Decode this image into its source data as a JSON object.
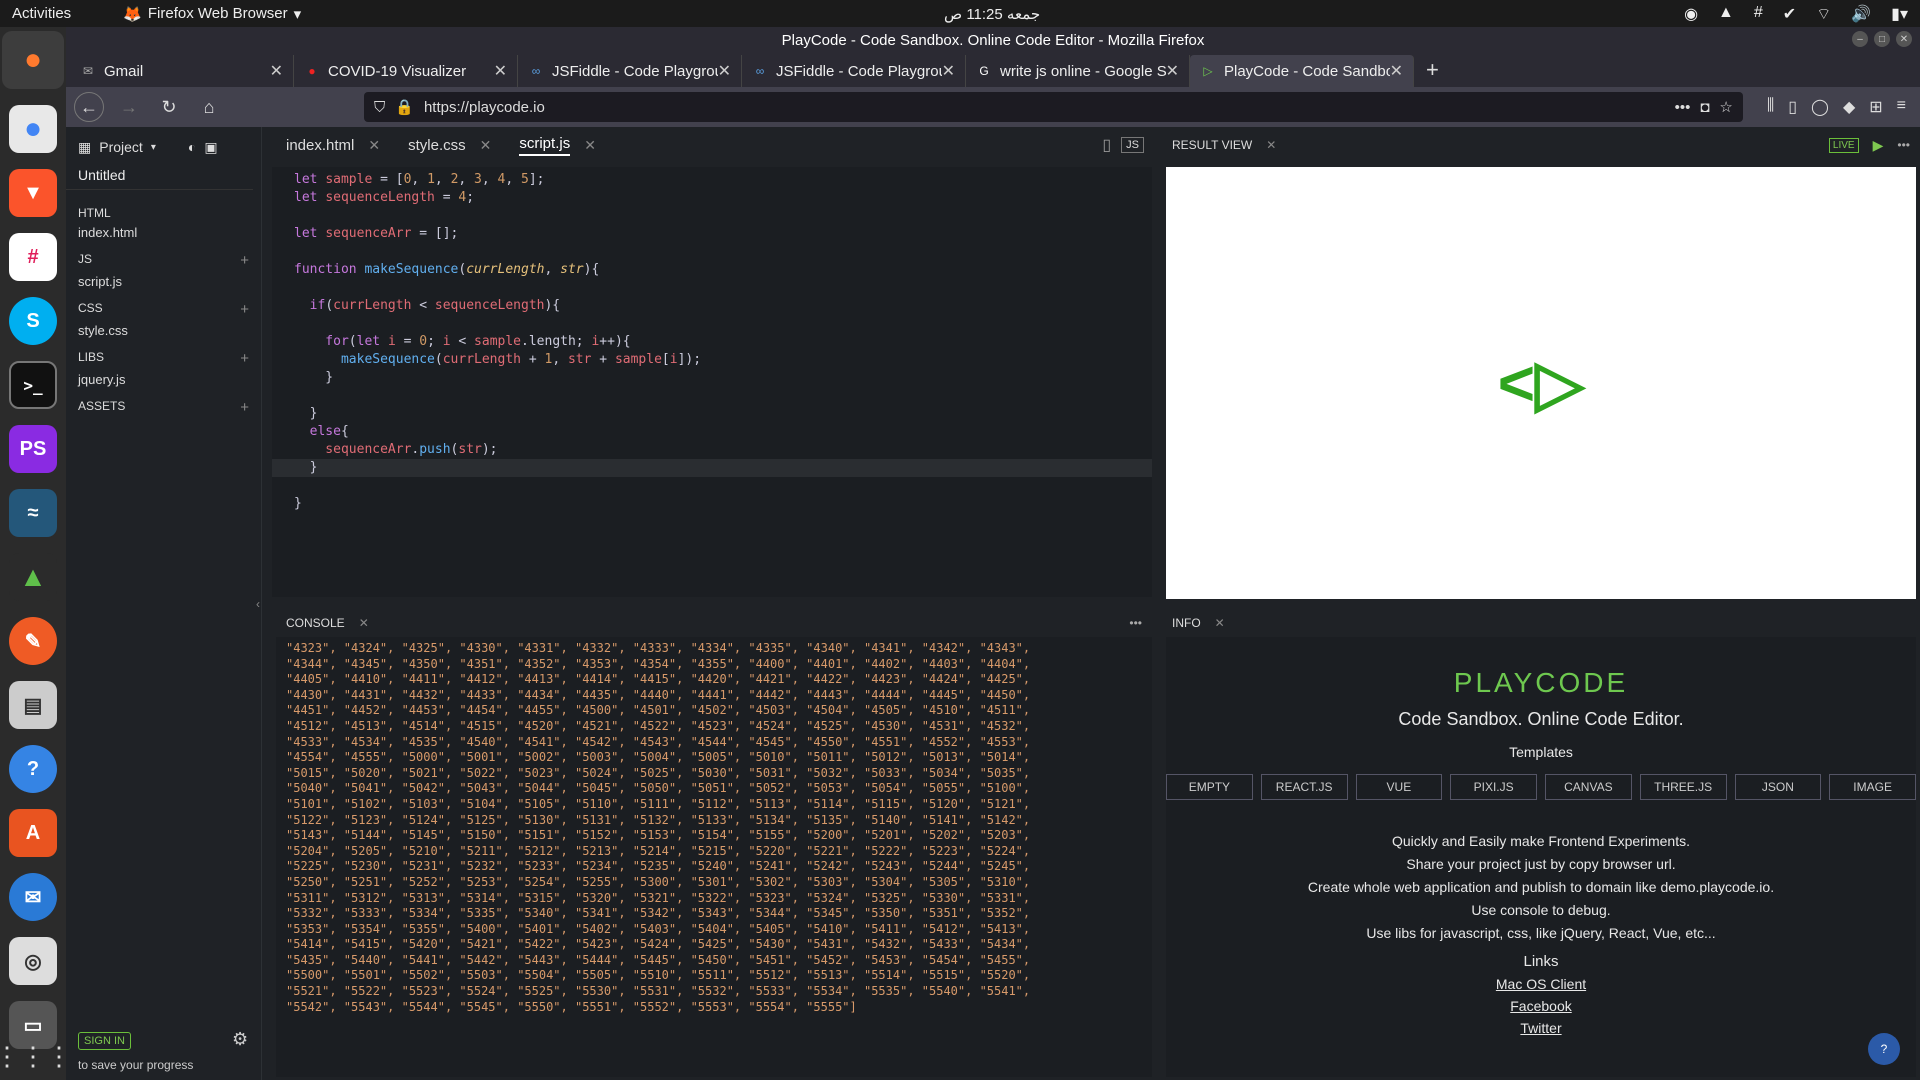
{
  "topbar": {
    "activities": "Activities",
    "browser_name": "Firefox Web Browser",
    "clock": "جمعه 11:25 ص"
  },
  "dock": {
    "apps": [
      "firefox-icon",
      "chrome-icon",
      "brave-icon",
      "slack-icon",
      "skype-icon",
      "terminal-icon",
      "phpstorm-icon",
      "mysql-workbench-icon",
      "rocket-icon",
      "postman-icon",
      "files-icon",
      "help-icon",
      "software-center-icon",
      "thunderbird-icon",
      "rhythmbox-icon",
      "screen-icon"
    ],
    "ps_label": "PS",
    "s_label": "S"
  },
  "window": {
    "title": "PlayCode - Code Sandbox. Online Code Editor - Mozilla Firefox"
  },
  "tabs": [
    {
      "label": "Gmail",
      "icon": "gmail-icon"
    },
    {
      "label": "COVID-19 Visualizer",
      "icon": "covid-icon"
    },
    {
      "label": "JSFiddle - Code Playgrou",
      "icon": "jsfiddle-icon"
    },
    {
      "label": "JSFiddle - Code Playgrou",
      "icon": "jsfiddle-icon"
    },
    {
      "label": "write js online - Google S",
      "icon": "google-icon"
    },
    {
      "label": "PlayCode - Code Sandbo",
      "icon": "playcode-icon"
    }
  ],
  "navbar": {
    "url": "https://playcode.io",
    "dots": "•••"
  },
  "sidebar": {
    "project_label": "Project",
    "title": "Untitled",
    "sections": [
      {
        "label": "HTML",
        "file": "index.html",
        "has_plus": false
      },
      {
        "label": "JS",
        "file": "script.js",
        "has_plus": true
      },
      {
        "label": "CSS",
        "file": "style.css",
        "has_plus": true
      },
      {
        "label": "LIBS",
        "file": "jquery.js",
        "has_plus": true
      },
      {
        "label": "ASSETS",
        "file": "",
        "has_plus": true
      }
    ],
    "signin": "SIGN IN",
    "save_progress": "to save your progress"
  },
  "editor": {
    "tabs": [
      "index.html",
      "style.css",
      "script.js"
    ],
    "active_tab": 2,
    "lang_badge": "JS"
  },
  "result": {
    "title": "RESULT VIEW",
    "live": "LIVE",
    "logo": "<▷"
  },
  "console": {
    "title": "CONSOLE",
    "output": "\"4323\", \"4324\", \"4325\", \"4330\", \"4331\", \"4332\", \"4333\", \"4334\", \"4335\", \"4340\", \"4341\", \"4342\", \"4343\",\n\"4344\", \"4345\", \"4350\", \"4351\", \"4352\", \"4353\", \"4354\", \"4355\", \"4400\", \"4401\", \"4402\", \"4403\", \"4404\",\n\"4405\", \"4410\", \"4411\", \"4412\", \"4413\", \"4414\", \"4415\", \"4420\", \"4421\", \"4422\", \"4423\", \"4424\", \"4425\",\n\"4430\", \"4431\", \"4432\", \"4433\", \"4434\", \"4435\", \"4440\", \"4441\", \"4442\", \"4443\", \"4444\", \"4445\", \"4450\",\n\"4451\", \"4452\", \"4453\", \"4454\", \"4455\", \"4500\", \"4501\", \"4502\", \"4503\", \"4504\", \"4505\", \"4510\", \"4511\",\n\"4512\", \"4513\", \"4514\", \"4515\", \"4520\", \"4521\", \"4522\", \"4523\", \"4524\", \"4525\", \"4530\", \"4531\", \"4532\",\n\"4533\", \"4534\", \"4535\", \"4540\", \"4541\", \"4542\", \"4543\", \"4544\", \"4545\", \"4550\", \"4551\", \"4552\", \"4553\",\n\"4554\", \"4555\", \"5000\", \"5001\", \"5002\", \"5003\", \"5004\", \"5005\", \"5010\", \"5011\", \"5012\", \"5013\", \"5014\",\n\"5015\", \"5020\", \"5021\", \"5022\", \"5023\", \"5024\", \"5025\", \"5030\", \"5031\", \"5032\", \"5033\", \"5034\", \"5035\",\n\"5040\", \"5041\", \"5042\", \"5043\", \"5044\", \"5045\", \"5050\", \"5051\", \"5052\", \"5053\", \"5054\", \"5055\", \"5100\",\n\"5101\", \"5102\", \"5103\", \"5104\", \"5105\", \"5110\", \"5111\", \"5112\", \"5113\", \"5114\", \"5115\", \"5120\", \"5121\",\n\"5122\", \"5123\", \"5124\", \"5125\", \"5130\", \"5131\", \"5132\", \"5133\", \"5134\", \"5135\", \"5140\", \"5141\", \"5142\",\n\"5143\", \"5144\", \"5145\", \"5150\", \"5151\", \"5152\", \"5153\", \"5154\", \"5155\", \"5200\", \"5201\", \"5202\", \"5203\",\n\"5204\", \"5205\", \"5210\", \"5211\", \"5212\", \"5213\", \"5214\", \"5215\", \"5220\", \"5221\", \"5222\", \"5223\", \"5224\",\n\"5225\", \"5230\", \"5231\", \"5232\", \"5233\", \"5234\", \"5235\", \"5240\", \"5241\", \"5242\", \"5243\", \"5244\", \"5245\",\n\"5250\", \"5251\", \"5252\", \"5253\", \"5254\", \"5255\", \"5300\", \"5301\", \"5302\", \"5303\", \"5304\", \"5305\", \"5310\",\n\"5311\", \"5312\", \"5313\", \"5314\", \"5315\", \"5320\", \"5321\", \"5322\", \"5323\", \"5324\", \"5325\", \"5330\", \"5331\",\n\"5332\", \"5333\", \"5334\", \"5335\", \"5340\", \"5341\", \"5342\", \"5343\", \"5344\", \"5345\", \"5350\", \"5351\", \"5352\",\n\"5353\", \"5354\", \"5355\", \"5400\", \"5401\", \"5402\", \"5403\", \"5404\", \"5405\", \"5410\", \"5411\", \"5412\", \"5413\",\n\"5414\", \"5415\", \"5420\", \"5421\", \"5422\", \"5423\", \"5424\", \"5425\", \"5430\", \"5431\", \"5432\", \"5433\", \"5434\",\n\"5435\", \"5440\", \"5441\", \"5442\", \"5443\", \"5444\", \"5445\", \"5450\", \"5451\", \"5452\", \"5453\", \"5454\", \"5455\",\n\"5500\", \"5501\", \"5502\", \"5503\", \"5504\", \"5505\", \"5510\", \"5511\", \"5512\", \"5513\", \"5514\", \"5515\", \"5520\",\n\"5521\", \"5522\", \"5523\", \"5524\", \"5525\", \"5530\", \"5531\", \"5532\", \"5533\", \"5534\", \"5535\", \"5540\", \"5541\",\n\"5542\", \"5543\", \"5544\", \"5545\", \"5550\", \"5551\", \"5552\", \"5553\", \"5554\", \"5555\"]"
  },
  "info": {
    "title": "INFO",
    "brand": "PLAYCODE",
    "subtitle": "Code Sandbox. Online Code Editor.",
    "templates_heading": "Templates",
    "templates": [
      "EMPTY",
      "REACT.JS",
      "VUE",
      "PIXI.JS",
      "CANVAS",
      "THREE.JS",
      "JSON",
      "IMAGE"
    ],
    "desc": [
      "Quickly and Easily make Frontend Experiments.",
      "Share your project just by copy browser url.",
      "Create whole web application and publish to domain like demo.playcode.io.",
      "Use console to debug.",
      "Use libs for javascript, css, like jQuery, React, Vue, etc..."
    ],
    "links_heading": "Links",
    "links": [
      "Mac OS Client",
      "Facebook",
      "Twitter"
    ],
    "help": "?"
  }
}
